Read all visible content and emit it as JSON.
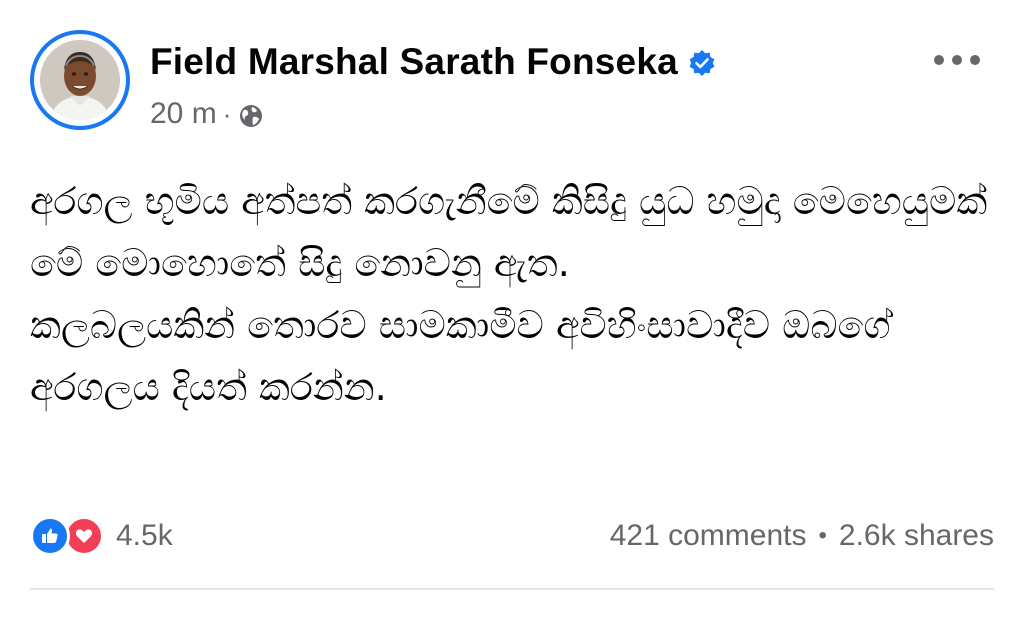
{
  "post": {
    "author": {
      "name": "Field Marshal Sarath Fonseka",
      "verified_icon": "verified-badge-icon",
      "avatar_icon": "profile-photo"
    },
    "meta": {
      "time": "20 m",
      "separator": "·",
      "audience_icon": "globe-icon"
    },
    "more_icon": "more-options-icon",
    "body": [
      "අරගල භූමිය අත්පත් කරගැනීමේ කිසිදු යුධ හමුදා මෙහෙයුමක් මේ මොහොතේ සිදු නොවනු ඇත.",
      "කලබලයකින් තොරව සාමකාමීව අවිහිංසාවාදීව ඔබගේ අරගලය දියත් කරන්න."
    ],
    "footer": {
      "reaction_icons": [
        "like-reaction-icon",
        "love-reaction-icon"
      ],
      "reaction_count": "4.5k",
      "comments": "421 comments",
      "separator": "•",
      "shares": "2.6k shares"
    }
  },
  "colors": {
    "accent": "#1877f2",
    "love": "#f33e58",
    "secondary_text": "#65676b",
    "divider": "#e4e6eb"
  }
}
